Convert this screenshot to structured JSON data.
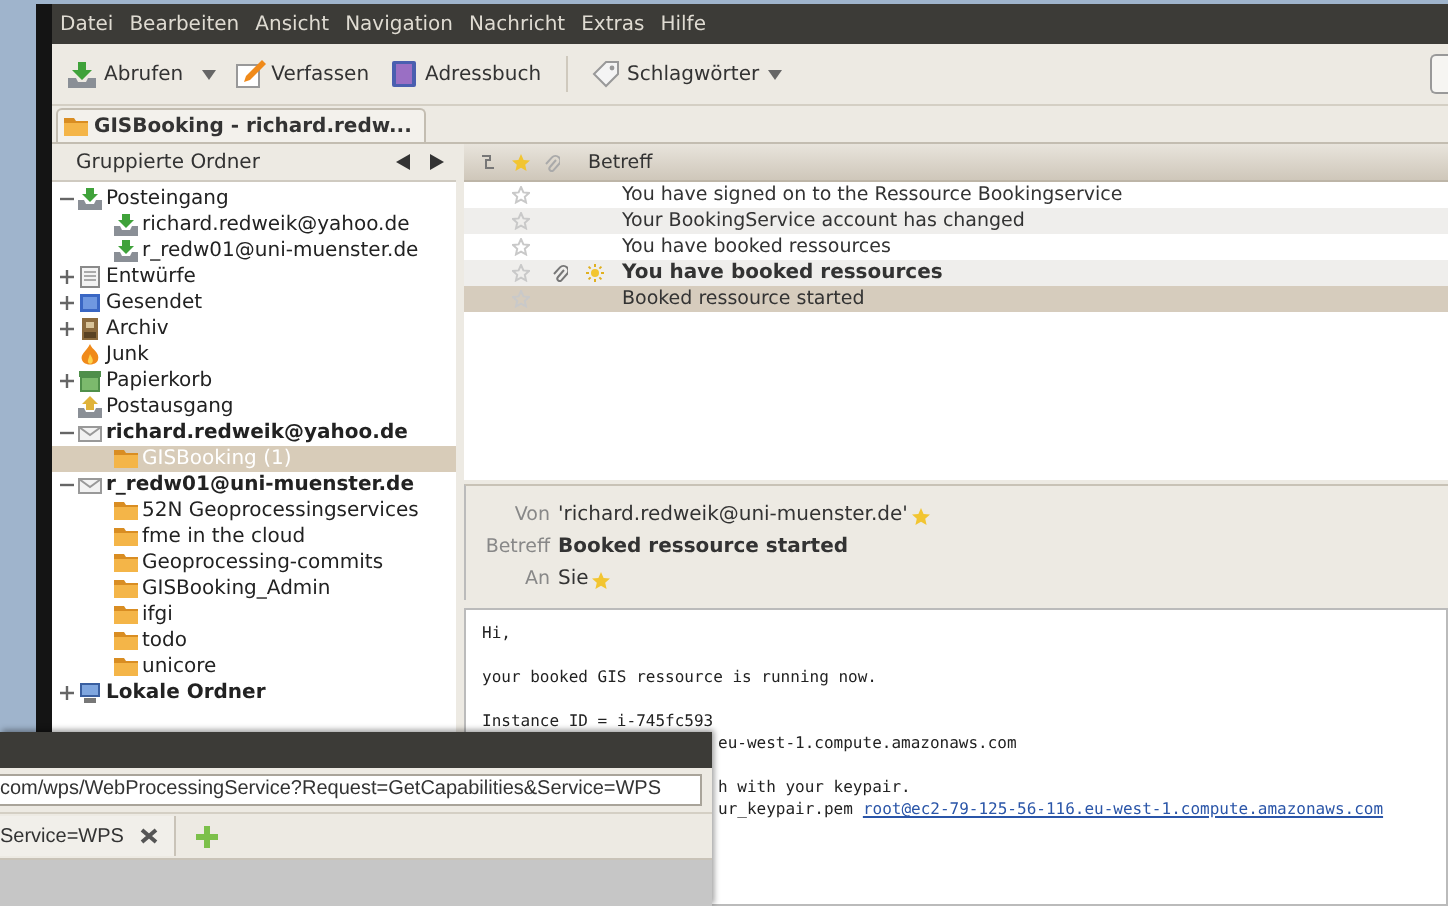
{
  "menu": [
    "Datei",
    "Bearbeiten",
    "Ansicht",
    "Navigation",
    "Nachricht",
    "Extras",
    "Hilfe"
  ],
  "toolbar": [
    {
      "kind": "get",
      "label": "Abrufen",
      "dropdown": true
    },
    {
      "kind": "compose",
      "label": "Verfassen",
      "dropdown": false
    },
    {
      "kind": "addressbook",
      "label": "Adressbuch",
      "dropdown": false
    },
    {
      "kind": "tags",
      "label": "Schlagwörter",
      "dropdown": true
    }
  ],
  "tab": {
    "title": "GISBooking - richard.redw..."
  },
  "folder_pane": {
    "title": "Gruppierte Ordner",
    "folders": [
      {
        "kind": "inbox",
        "label": "Posteingang",
        "expanded": true,
        "selected": false,
        "children": [
          {
            "kind": "inbox",
            "label": "richard.redweik@yahoo.de",
            "selected": false
          },
          {
            "kind": "inbox",
            "label": "r_redw01@uni-muenster.de",
            "selected": false
          }
        ]
      },
      {
        "kind": "drafts",
        "label": "Entwürfe",
        "expanded": false,
        "selected": false
      },
      {
        "kind": "sent",
        "label": "Gesendet",
        "expanded": false,
        "selected": false
      },
      {
        "kind": "archive",
        "label": "Archiv",
        "expanded": false,
        "selected": false
      },
      {
        "kind": "junk",
        "label": "Junk",
        "selected": false
      },
      {
        "kind": "trash",
        "label": "Papierkorb",
        "expanded": false,
        "selected": false
      },
      {
        "kind": "outbox",
        "label": "Postausgang",
        "selected": false
      },
      {
        "kind": "account",
        "label": "richard.redweik@yahoo.de",
        "expanded": true,
        "selected": false,
        "children": [
          {
            "kind": "folder",
            "label": "GISBooking (1)",
            "selected": true
          }
        ]
      },
      {
        "kind": "account",
        "label": "r_redw01@uni-muenster.de",
        "expanded": true,
        "selected": false,
        "children": [
          {
            "kind": "folder",
            "label": "52N Geoprocessingservices",
            "selected": false
          },
          {
            "kind": "folder",
            "label": "fme in the cloud",
            "selected": false
          },
          {
            "kind": "folder",
            "label": "Geoprocessing-commits",
            "selected": false
          },
          {
            "kind": "folder",
            "label": "GISBooking_Admin",
            "selected": false
          },
          {
            "kind": "folder",
            "label": "ifgi",
            "selected": false
          },
          {
            "kind": "folder",
            "label": "todo",
            "selected": false
          },
          {
            "kind": "folder",
            "label": "unicore",
            "selected": false
          }
        ]
      },
      {
        "kind": "local",
        "label": "Lokale Ordner",
        "expanded": false,
        "selected": false
      }
    ]
  },
  "message_list": {
    "column": "Betreff",
    "messages": [
      {
        "subject": "You have signed on to the Ressource Bookingservice",
        "unread": false,
        "attachment": false,
        "selected": false
      },
      {
        "subject": "Your BookingService account has changed",
        "unread": false,
        "attachment": false,
        "selected": false
      },
      {
        "subject": "You have booked ressources",
        "unread": false,
        "attachment": false,
        "selected": false
      },
      {
        "subject": "You have booked ressources",
        "unread": true,
        "attachment": true,
        "selected": false
      },
      {
        "subject": "Booked ressource started",
        "unread": false,
        "attachment": false,
        "selected": true
      }
    ]
  },
  "message": {
    "from_label": "Von",
    "from": "'richard.redweik@uni-muenster.de'",
    "subject_label": "Betreff",
    "subject": "Booked ressource started",
    "to_label": "An",
    "to": "Sie",
    "body": [
      {
        "lines": [
          {
            "kind": "full",
            "text": "Hi,"
          }
        ]
      },
      {
        "lines": [
          {
            "kind": "full",
            "text": "your booked GIS ressource is running now."
          }
        ]
      },
      {
        "lines": [
          {
            "kind": "full",
            "text": "Instance ID = i-745fc593"
          },
          {
            "kind": "fragment",
            "text": "eu-west-1.compute.amazonaws.com"
          }
        ]
      },
      {
        "lines": [
          {
            "kind": "fragment",
            "text": "h with your keypair."
          },
          {
            "kind": "fragment",
            "text": "ur_keypair.pem",
            "link": "root@ec2-79-125-56-116.eu-west-1.compute.amazonaws.com"
          }
        ]
      }
    ]
  },
  "browser": {
    "address": "com/wps/WebProcessingService?Request=GetCapabilities&Service=WPS",
    "tab": "Service=WPS"
  }
}
